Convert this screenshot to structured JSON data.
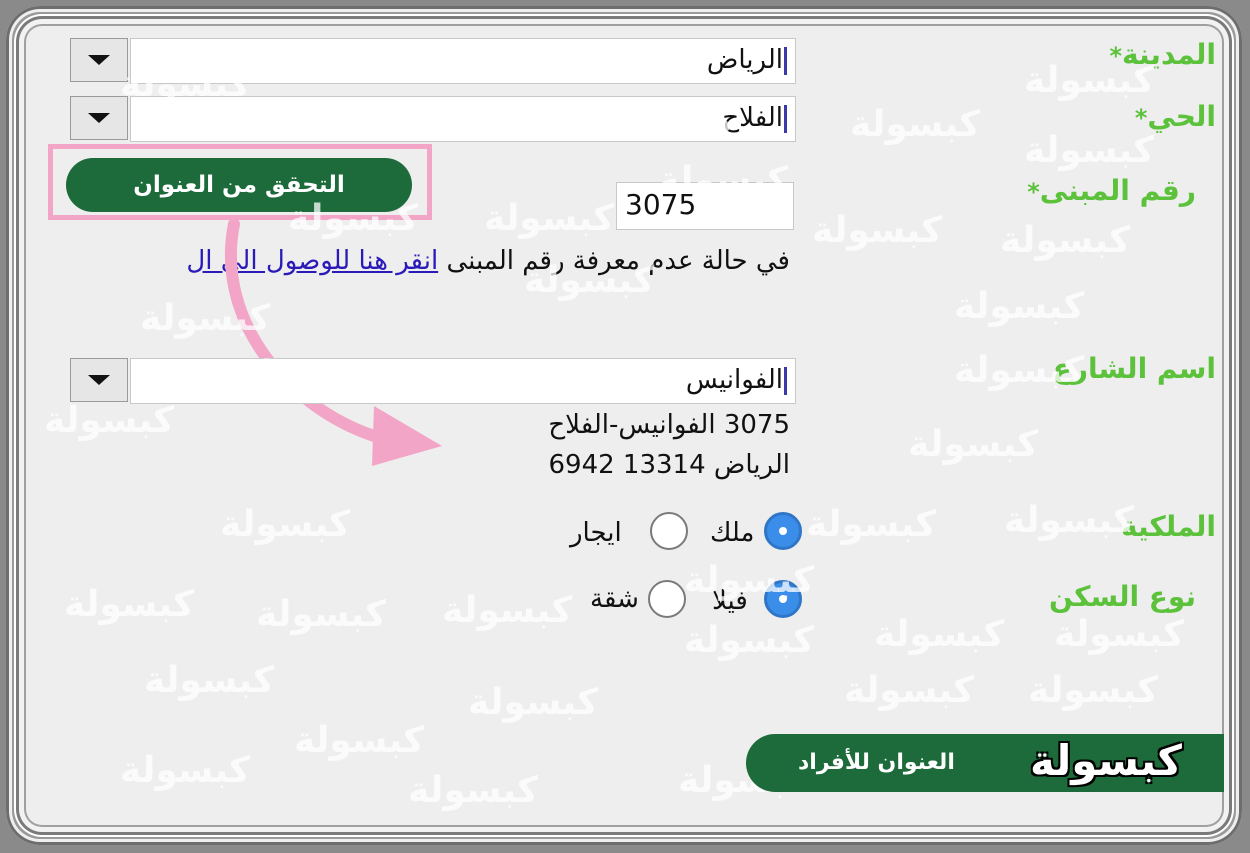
{
  "form": {
    "city": {
      "label": "المدينة",
      "required_mark": "*",
      "value": "الرياض"
    },
    "district": {
      "label": "الحي",
      "required_mark": "*",
      "value": "الفلاح"
    },
    "building_number": {
      "label": "رقم المبنى",
      "required_mark": "*",
      "value": "3075"
    },
    "verify_button": "التحقق من العنوان",
    "hint_text": "في حالة عدم معرفة رقم المبنى",
    "hint_link": "انقر هنا للوصول الى ال",
    "street": {
      "label": "اسم الشارع",
      "value": "الفوانيس"
    },
    "address_line1": "3075 الفوانيس-الفلاح",
    "address_line2": "الرياض 13314 6942",
    "ownership": {
      "label": "الملكية",
      "options": [
        "ملك",
        "ايجار"
      ],
      "selected": "ملك"
    },
    "housing_type": {
      "label": "نوع السكن",
      "options": [
        "فيلا",
        "شقة"
      ],
      "selected": "فيلا"
    },
    "register_button": "العنوان للأفراد"
  },
  "watermark": {
    "text": "كبسولة",
    "brand": "كبسولة"
  },
  "colors": {
    "label_green": "#5cc23c",
    "button_green": "#1d6b3b",
    "radio_blue": "#3b8dea",
    "highlight_pink": "#f2a5c6",
    "link_purple": "#2a1ab8"
  }
}
